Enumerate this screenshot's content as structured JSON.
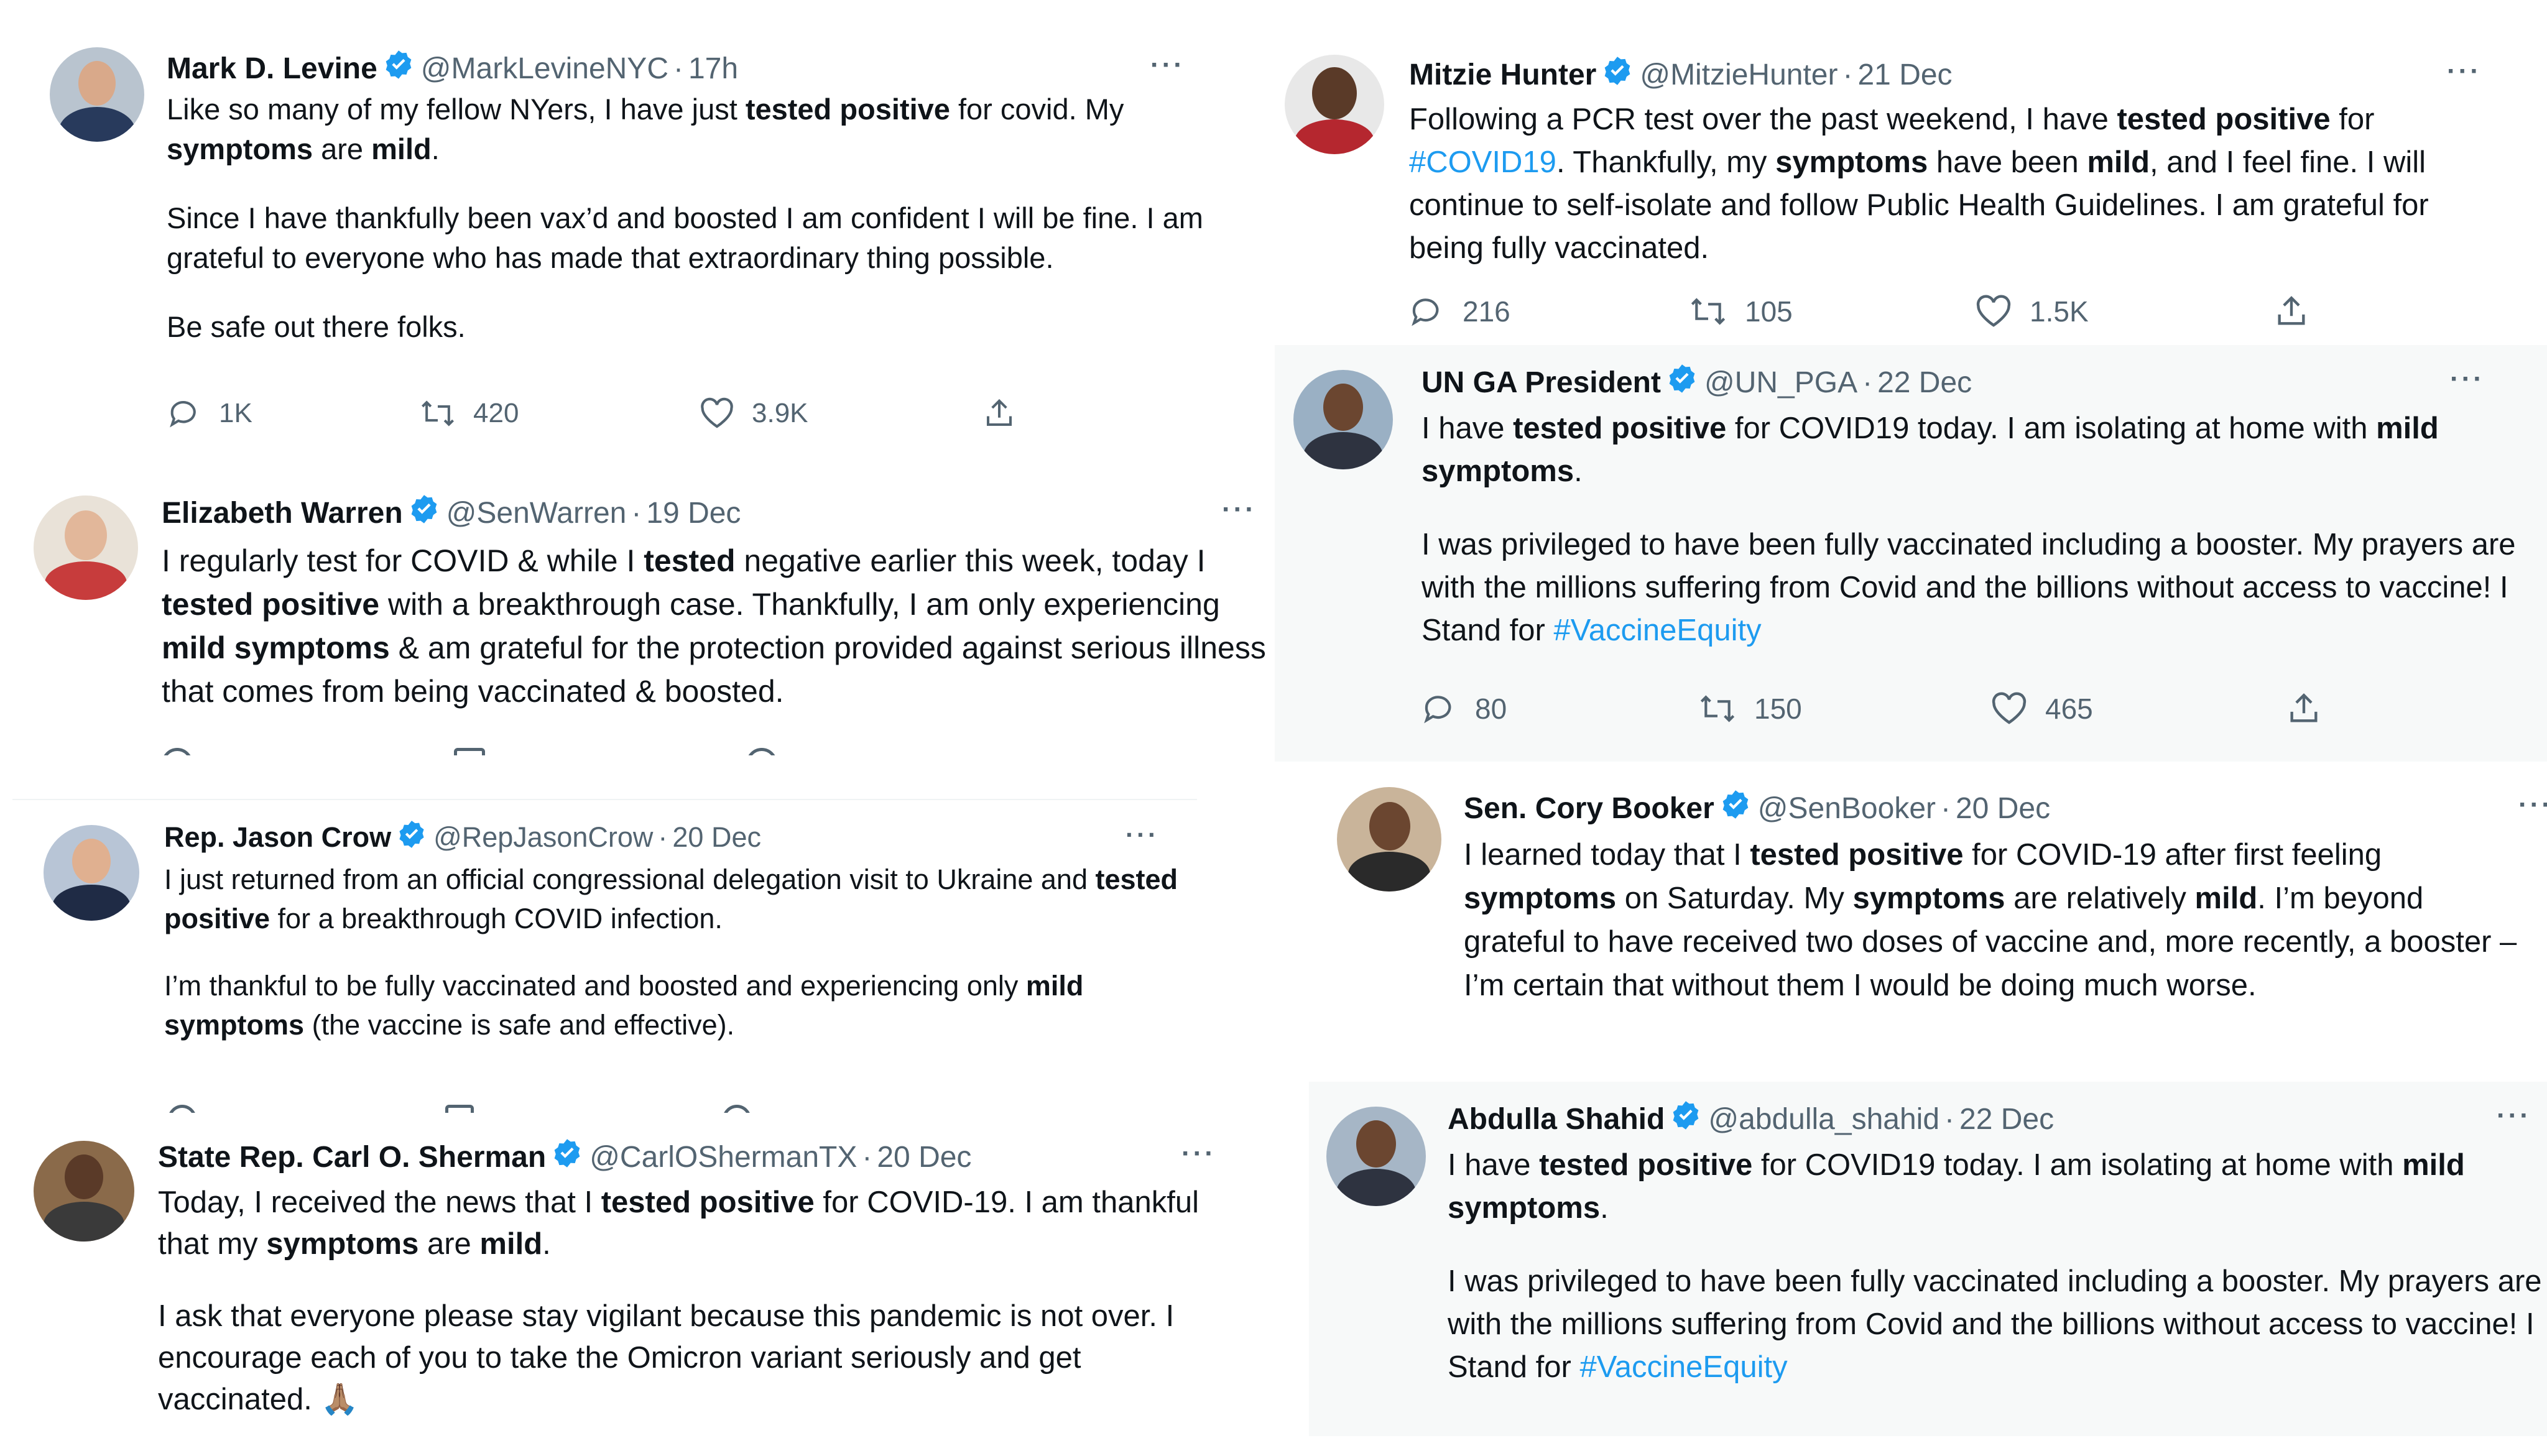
{
  "tweets": [
    {
      "name": "Mark D. Levine",
      "handle": "@MarkLevineNYC",
      "time": "17h",
      "p1_a": "Like so many of my fellow NYers, I have just ",
      "p1_b": "tested positive",
      "p1_c": " for covid. My ",
      "p1_d": "symptoms",
      "p1_e": " are ",
      "p1_f": "mild",
      "p1_g": ".",
      "p2": "Since I have thankfully been vax’d and boosted I am confident I will be fine. I am grateful to everyone who has made that extraordinary thing possible.",
      "p3": "Be safe out there folks.",
      "replies": "1K",
      "retweets": "420",
      "likes": "3.9K"
    },
    {
      "name": "Mitzie Hunter",
      "handle": "@MitzieHunter",
      "time": "21 Dec",
      "p1_a": "Following a PCR test over the past weekend, I have ",
      "p1_b": "tested positive",
      "p1_c": " for ",
      "p1_hashtag": "#COVID19",
      "p1_d": ". Thankfully, my ",
      "p1_e": "symptoms",
      "p1_f": " have been ",
      "p1_g": "mild",
      "p1_h": ", and I feel fine. I will continue to self-isolate and follow Public Health Guidelines. I am grateful for being fully vaccinated.",
      "replies": "216",
      "retweets": "105",
      "likes": "1.5K"
    },
    {
      "name": "UN GA President",
      "handle": "@UN_PGA",
      "time": "22 Dec",
      "p1_a": "I have ",
      "p1_b": "tested positive",
      "p1_c": " for COVID19 today. I am isolating at home with ",
      "p1_d": "mild symptoms",
      "p1_e": ".",
      "p2_a": "I was privileged to have been fully vaccinated including a booster. My prayers are with the millions suffering from Covid and the billions without access to vaccine! I Stand for ",
      "p2_hashtag": "#VaccineEquity",
      "replies": "80",
      "retweets": "150",
      "likes": "465"
    },
    {
      "name": "Elizabeth Warren",
      "handle": "@SenWarren",
      "time": "19 Dec",
      "p1_a": "I regularly test for COVID & while I ",
      "p1_b": "tested",
      "p1_c": " negative earlier this week, today I ",
      "p1_d": "tested positive",
      "p1_e": " with a breakthrough case. Thankfully, I am only experiencing ",
      "p1_f": "mild symptoms",
      "p1_g": " & am grateful for the protection provided against serious illness that comes from being vaccinated & boosted."
    },
    {
      "name": "Rep. Jason Crow",
      "handle": "@RepJasonCrow",
      "time": "20 Dec",
      "p1_a": "I just returned from an official congressional delegation visit to Ukraine and ",
      "p1_b": "tested positive",
      "p1_c": " for a breakthrough COVID infection.",
      "p2_a": "I’m thankful to be fully vaccinated and boosted and experiencing only ",
      "p2_b": "mild symptoms",
      "p2_c": " (the vaccine is safe and effective)."
    },
    {
      "name": "Sen. Cory Booker",
      "handle": "@SenBooker",
      "time": "20 Dec",
      "p1_a": "I learned today that I ",
      "p1_b": "tested positive",
      "p1_c": " for COVID-19 after first feeling ",
      "p1_d": "symptoms",
      "p1_e": " on Saturday. My ",
      "p1_f": "symptoms",
      "p1_g": " are relatively ",
      "p1_h": "mild",
      "p1_i": ". I’m beyond grateful to have received two doses of vaccine and, more recently, a booster – I’m certain that without them I would be doing much worse."
    },
    {
      "name": "State Rep. Carl O. Sherman",
      "handle": "@CarlOShermanTX",
      "time": "20 Dec",
      "p1_a": "Today, I received the news that I ",
      "p1_b": "tested positive",
      "p1_c": " for COVID-19. I am thankful that my ",
      "p1_d": "symptoms",
      "p1_e": " are ",
      "p1_f": "mild",
      "p1_g": ".",
      "p2": "I ask that everyone please stay vigilant because this pandemic is not over. I encourage each of you to take the Omicron variant seriously and get vaccinated. ",
      "emoji": "🙏🏽"
    },
    {
      "name": "Abdulla Shahid",
      "handle": "@abdulla_shahid",
      "time": "22 Dec",
      "p1_a": "I have ",
      "p1_b": "tested positive",
      "p1_c": " for COVID19 today. I am isolating at home with ",
      "p1_d": "mild symptoms",
      "p1_e": ".",
      "p2_a": "I was privileged to have been fully vaccinated including a booster. My prayers are with the millions suffering from Covid and the billions without access to vaccine! I Stand for ",
      "p2_hashtag": "#VaccineEquity"
    }
  ],
  "separator": "·",
  "more": "···",
  "colors": {
    "verified": "#1d9bf0",
    "hashtag": "#1d9bf0",
    "muted": "#536471"
  }
}
